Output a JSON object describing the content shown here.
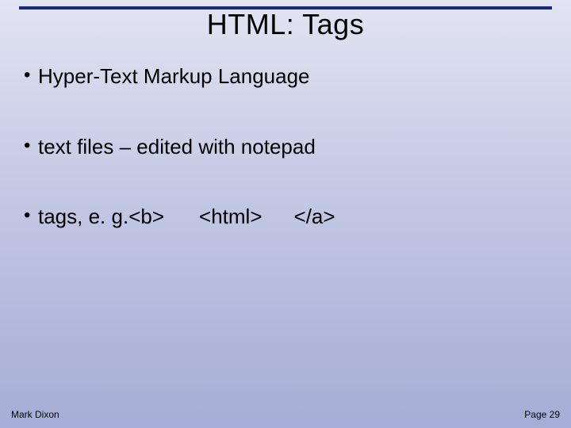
{
  "title": "HTML: Tags",
  "bullets": [
    {
      "text": "Hyper-Text Markup Language"
    },
    {
      "text": "text files – edited with notepad"
    }
  ],
  "tagsBullet": {
    "lead": "tags, e. g. ",
    "ex1": "<b>",
    "ex2": "<html>",
    "ex3": "</a>"
  },
  "footer": {
    "author": "Mark Dixon",
    "page": "Page 29"
  }
}
